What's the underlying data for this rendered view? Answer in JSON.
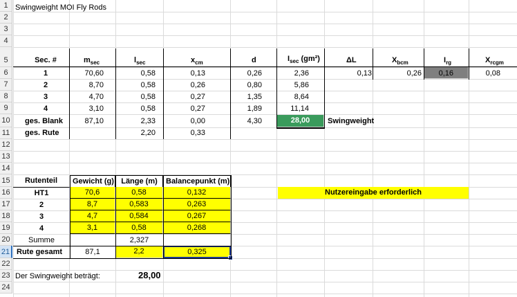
{
  "title": "Swingweight MOI Fly Rods",
  "rows": [
    "1",
    "2",
    "3",
    "4",
    "5",
    "6",
    "7",
    "8",
    "9",
    "10",
    "11",
    "12",
    "13",
    "14",
    "15",
    "16",
    "17",
    "18",
    "19",
    "20",
    "21",
    "22",
    "23",
    "24"
  ],
  "header": {
    "sec": "Sec. #",
    "m": "m",
    "m_sub": "sec",
    "l": "l",
    "l_sub": "sec",
    "x": "x",
    "x_sub": "cm",
    "d": "d",
    "i": "I",
    "i_sub": "sec",
    "i_unit": " (gm²)",
    "dl": "ΔL",
    "xb": "X",
    "xb_sub": "bcm",
    "irg": "I",
    "irg_sub": "rg",
    "xr": "X",
    "xr_sub": "rcgm"
  },
  "table1": [
    {
      "sec": "1",
      "m": "70,60",
      "l": "0,58",
      "x": "0,13",
      "d": "0,26",
      "i": "2,36"
    },
    {
      "sec": "2",
      "m": "8,70",
      "l": "0,58",
      "x": "0,26",
      "d": "0,80",
      "i": "5,86"
    },
    {
      "sec": "3",
      "m": "4,70",
      "l": "0,58",
      "x": "0,27",
      "d": "1,35",
      "i": "8,64"
    },
    {
      "sec": "4",
      "m": "3,10",
      "l": "0,58",
      "x": "0,27",
      "d": "1,89",
      "i": "11,14"
    }
  ],
  "row6_extra": {
    "dl": "0,13",
    "xb": "0,26",
    "irg": "0,16",
    "xr": "0,08"
  },
  "row10": {
    "label": "ges. Blank",
    "m": "87,10",
    "l": "2,33",
    "x": "0,00",
    "d": "4,30",
    "i": "28,00",
    "swing": "Swingweight"
  },
  "row11": {
    "label": "ges. Rute",
    "l": "2,20",
    "x": "0,33"
  },
  "table2_header": {
    "part": "Rutenteil",
    "weight": "Gewicht (g)",
    "length": "Länge (m)",
    "balance": "Balancepunkt (m)"
  },
  "table2": [
    {
      "part": "HT1",
      "weight": "70,6",
      "length": "0,58",
      "balance": "0,132"
    },
    {
      "part": "2",
      "weight": "8,7",
      "length": "0,583",
      "balance": "0,263"
    },
    {
      "part": "3",
      "weight": "4,7",
      "length": "0,584",
      "balance": "0,267"
    },
    {
      "part": "4",
      "weight": "3,1",
      "length": "0,58",
      "balance": "0,268"
    }
  ],
  "summe": {
    "label": "Summe",
    "length": "2,327"
  },
  "gesamt": {
    "label": "Rute gesamt",
    "weight": "87,1",
    "length": "2,2",
    "balance": "0,325"
  },
  "note": "Nutzereingabe erforderlich",
  "result": {
    "label": "Der Swingweight beträgt:",
    "value": "28,00"
  }
}
